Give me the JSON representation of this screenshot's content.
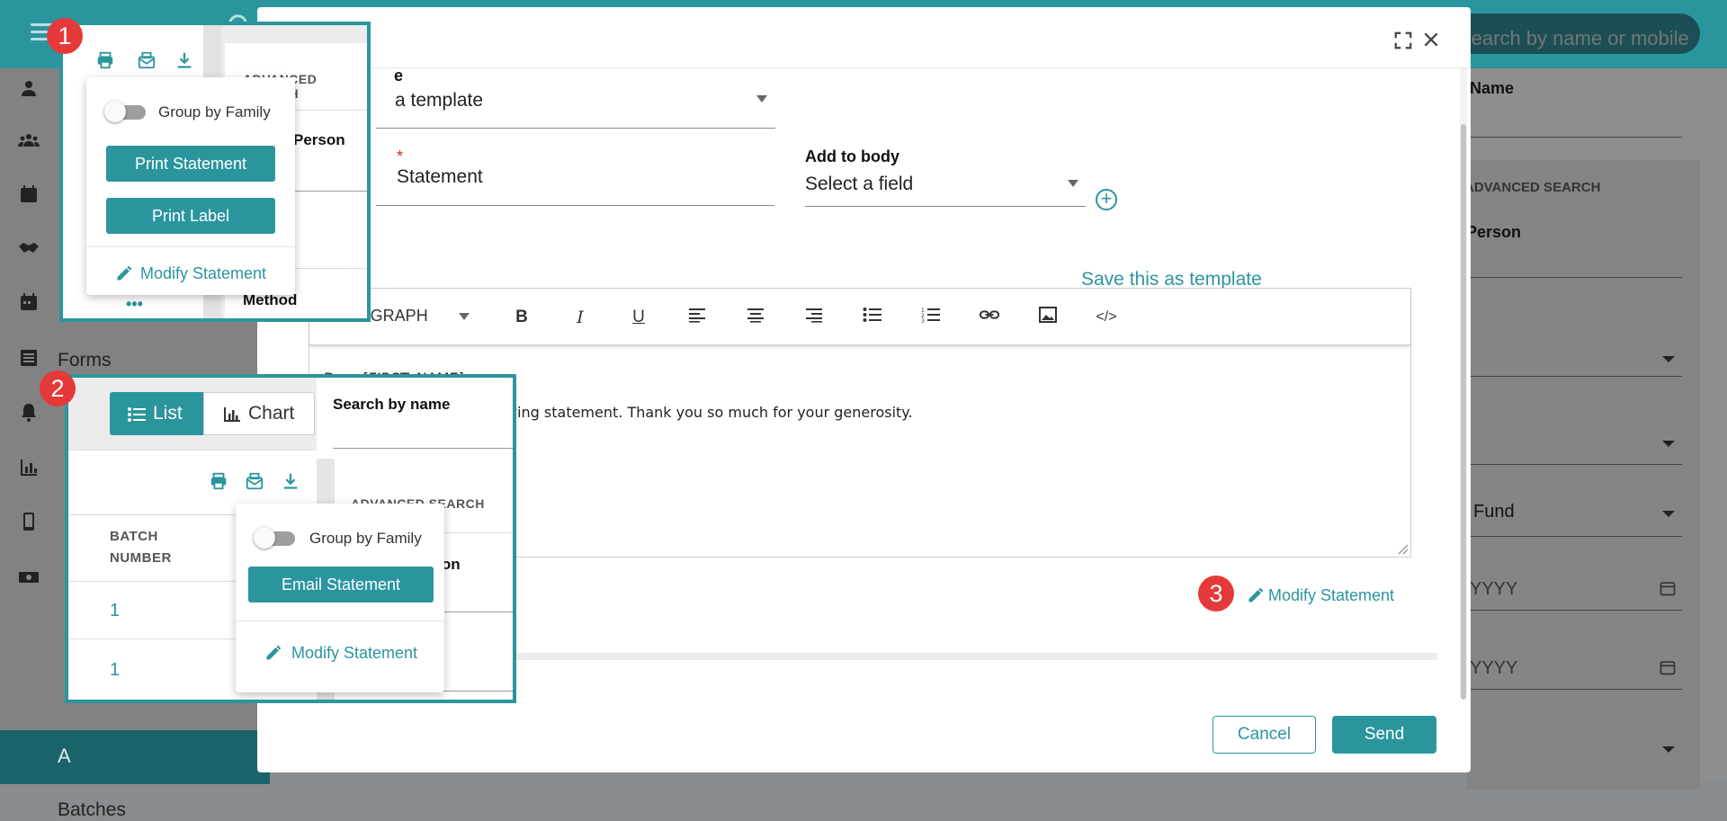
{
  "app": {
    "global_search_placeholder": "Search by name or mobile",
    "sidebar_items": [
      "Forms",
      "Batches"
    ],
    "right_panel": {
      "name_header": "Name",
      "advanced_search": "ADVANCED SEARCH",
      "person_label": "Person",
      "fund_value": "Fund",
      "date_placeholder_1": "YYYY",
      "date_placeholder_2": "YYYY"
    }
  },
  "modal": {
    "template_field": {
      "label_fragment": "e",
      "value": "a template"
    },
    "subject_field": {
      "value": "Statement",
      "required_mark": "*"
    },
    "add_to_body": {
      "label": "Add to body",
      "value": "Select a field"
    },
    "save_template_link": "Save this as template",
    "editor": {
      "format_select": "PARAGRAPH",
      "line1": "Dear [FIRST_NAME],",
      "line2": "giving statement. Thank you so much for your generosity."
    },
    "modify_statement_link": "Modify Statement",
    "cancel_label": "Cancel",
    "send_label": "Send"
  },
  "callouts": {
    "c1": {
      "badge": "1",
      "advanced_search": "ADVANCED SEARCH",
      "person_label": "Person",
      "method_label": "Method",
      "more": "•••",
      "popover": {
        "group_by_family": "Group by Family",
        "print_statement": "Print Statement",
        "print_label": "Print Label",
        "modify_statement": "Modify Statement"
      }
    },
    "c2": {
      "badge": "2",
      "list_tab": "List",
      "chart_tab": "Chart",
      "search_by_name": "Search by name",
      "advanced_search": "ADVANCED SEARCH",
      "person_label": "Person",
      "batch_header_1": "BATCH",
      "batch_header_2": "NUMBER",
      "rows": [
        "1",
        "1"
      ],
      "popover": {
        "group_by_family": "Group by Family",
        "email_statement": "Email Statement",
        "modify_statement": "Modify Statement"
      }
    },
    "c3": {
      "badge": "3"
    }
  },
  "colors": {
    "accent": "#2b959e",
    "badge": "#e53939",
    "header": "#2b959e"
  },
  "icons": [
    "menu-icon",
    "search-icon",
    "expand-icon",
    "close-icon",
    "print-icon",
    "email-icon",
    "download-icon",
    "pencil-icon",
    "list-icon",
    "chart-icon",
    "bold-icon",
    "italic-icon",
    "underline-icon",
    "align-left-icon",
    "align-center-icon",
    "align-right-icon",
    "bullet-list-icon",
    "numbered-list-icon",
    "link-icon",
    "image-icon",
    "code-icon",
    "plus-circle-icon"
  ]
}
